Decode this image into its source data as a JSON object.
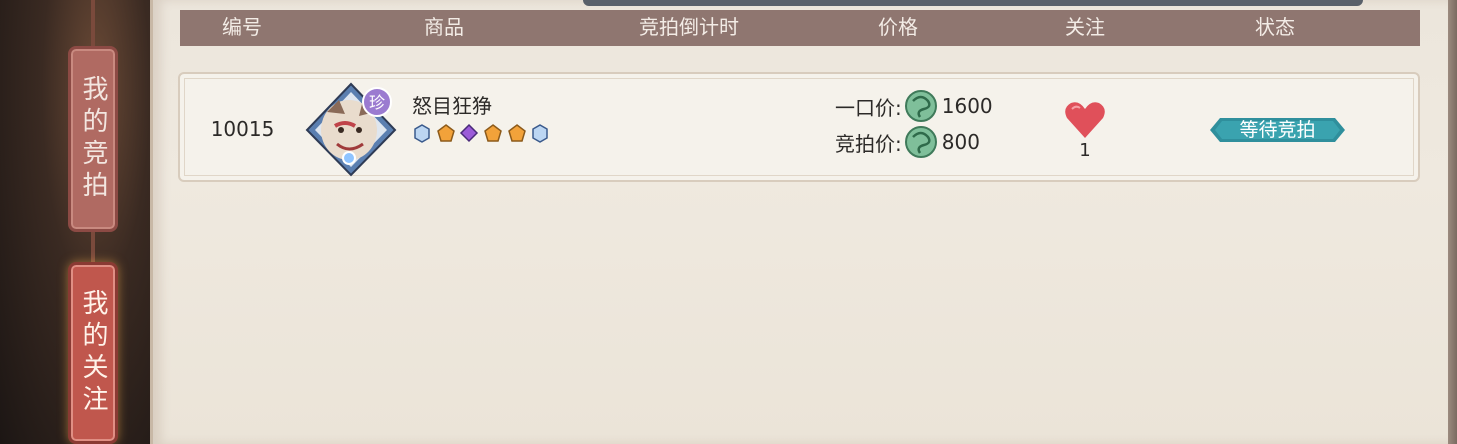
{
  "header": {
    "col_id": "编号",
    "col_item": "商品",
    "col_countdown": "竞拍倒计时",
    "col_price": "价格",
    "col_follow": "关注",
    "col_status": "状态"
  },
  "sidebar": {
    "tabs": [
      {
        "label": "我的竞拍",
        "active": false
      },
      {
        "label": "我的关注",
        "active": true
      }
    ]
  },
  "listings": [
    {
      "id": "10015",
      "name": "怒目狂狰",
      "badge": "珍",
      "gems": [
        "blue-hex",
        "orange-pentagon",
        "purple-diamond",
        "orange-pentagon",
        "orange-pentagon",
        "blue-hex"
      ],
      "buyout_label": "一口价:",
      "buyout_price": "1600",
      "bid_label": "竞拍价:",
      "bid_price": "800",
      "currency_icon": "jade-dragon-icon",
      "follow_count": "1",
      "status": "等待竞拍"
    }
  ],
  "colors": {
    "header_bg": "#8f7670",
    "status_badge": "#2f8f9c",
    "heart": "#e0505a",
    "tab_active": "#c0574d"
  }
}
